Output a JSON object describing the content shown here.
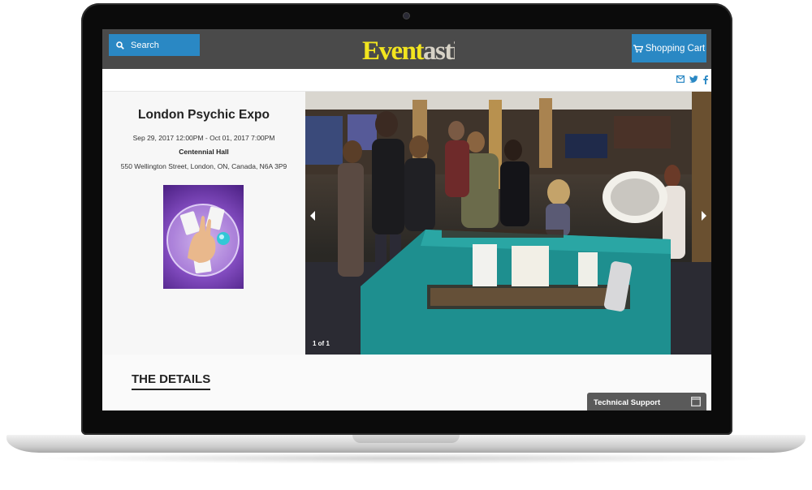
{
  "header": {
    "search_label": "Search",
    "logo_text": "Eventastic",
    "cart_label": "Shopping Cart"
  },
  "share": {
    "icons": [
      "email-icon",
      "twitter-icon",
      "facebook-icon"
    ]
  },
  "event": {
    "title": "London Psychic Expo",
    "dates": "Sep 29, 2017 12:00PM - Oct 01, 2017 7:00PM",
    "venue": "Centennial Hall",
    "address": "550 Wellington Street, London, ON, Canada, N6A 3P9"
  },
  "slider": {
    "counter": "1 of 1"
  },
  "details": {
    "heading": "THE DETAILS"
  },
  "support": {
    "label": "Technical Support"
  },
  "colors": {
    "accent": "#2a88c4",
    "topbar": "#4a4a4a",
    "logo": "#f2e51f"
  }
}
